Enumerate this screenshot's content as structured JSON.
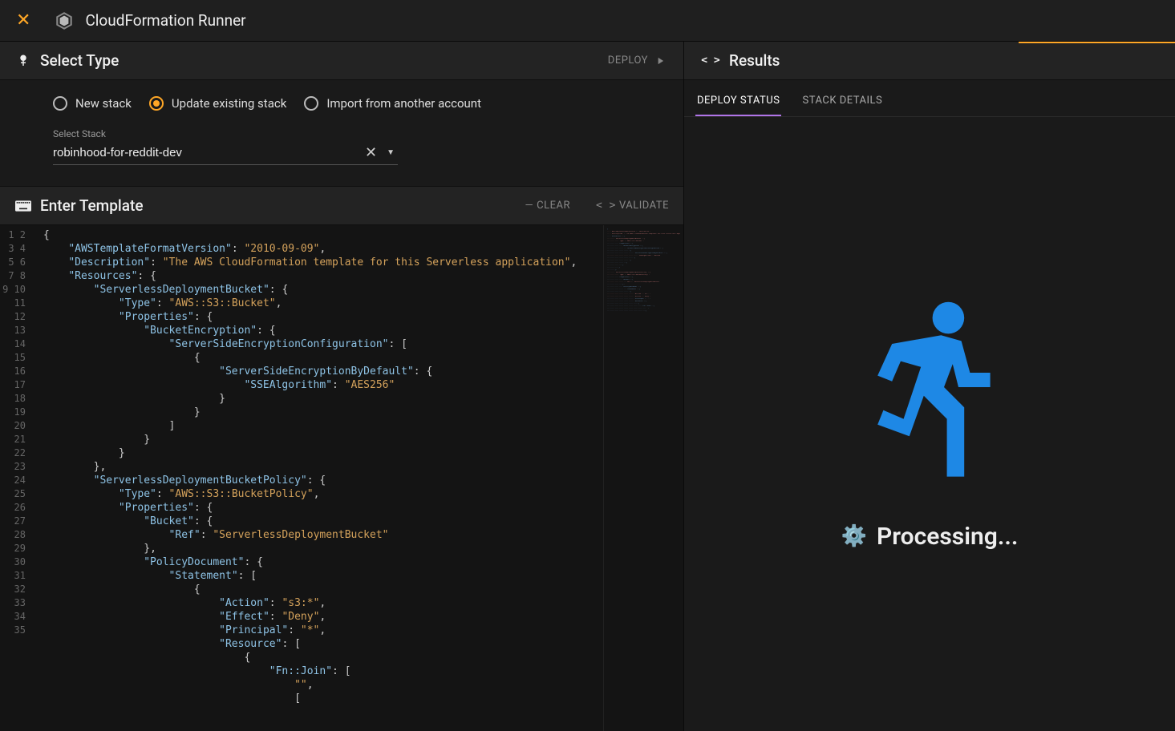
{
  "titlebar": {
    "app_name": "CloudFormation Runner"
  },
  "select_type": {
    "header": "Select Type",
    "deploy_label": "DEPLOY",
    "radios": {
      "new_stack": "New stack",
      "update_existing": "Update existing stack",
      "import": "Import from another account",
      "selected": "update_existing"
    },
    "stack_label": "Select Stack",
    "stack_value": "robinhood-for-reddit-dev"
  },
  "enter_template": {
    "header": "Enter Template",
    "clear_label": "CLEAR",
    "validate_label": "VALIDATE"
  },
  "code_lines": [
    [
      [
        "brace",
        "{"
      ]
    ],
    [
      [
        "sp",
        "    "
      ],
      [
        "key",
        "\"AWSTemplateFormatVersion\""
      ],
      [
        "punc",
        ": "
      ],
      [
        "str",
        "\"2010-09-09\""
      ],
      [
        "punc",
        ","
      ]
    ],
    [
      [
        "sp",
        "    "
      ],
      [
        "key",
        "\"Description\""
      ],
      [
        "punc",
        ": "
      ],
      [
        "str",
        "\"The AWS CloudFormation template for this Serverless application\""
      ],
      [
        "punc",
        ","
      ]
    ],
    [
      [
        "sp",
        "    "
      ],
      [
        "key",
        "\"Resources\""
      ],
      [
        "punc",
        ": "
      ],
      [
        "brace",
        "{"
      ]
    ],
    [
      [
        "sp",
        "        "
      ],
      [
        "key",
        "\"ServerlessDeploymentBucket\""
      ],
      [
        "punc",
        ": "
      ],
      [
        "brace",
        "{"
      ]
    ],
    [
      [
        "sp",
        "            "
      ],
      [
        "key",
        "\"Type\""
      ],
      [
        "punc",
        ": "
      ],
      [
        "str",
        "\"AWS::S3::Bucket\""
      ],
      [
        "punc",
        ","
      ]
    ],
    [
      [
        "sp",
        "            "
      ],
      [
        "key",
        "\"Properties\""
      ],
      [
        "punc",
        ": "
      ],
      [
        "brace",
        "{"
      ]
    ],
    [
      [
        "sp",
        "                "
      ],
      [
        "key",
        "\"BucketEncryption\""
      ],
      [
        "punc",
        ": "
      ],
      [
        "brace",
        "{"
      ]
    ],
    [
      [
        "sp",
        "                    "
      ],
      [
        "key",
        "\"ServerSideEncryptionConfiguration\""
      ],
      [
        "punc",
        ": "
      ],
      [
        "brace",
        "["
      ]
    ],
    [
      [
        "sp",
        "                        "
      ],
      [
        "brace",
        "{"
      ]
    ],
    [
      [
        "sp",
        "                            "
      ],
      [
        "key",
        "\"ServerSideEncryptionByDefault\""
      ],
      [
        "punc",
        ": "
      ],
      [
        "brace",
        "{"
      ]
    ],
    [
      [
        "sp",
        "                                "
      ],
      [
        "key",
        "\"SSEAlgorithm\""
      ],
      [
        "punc",
        ": "
      ],
      [
        "str",
        "\"AES256\""
      ]
    ],
    [
      [
        "sp",
        "                            "
      ],
      [
        "brace",
        "}"
      ]
    ],
    [
      [
        "sp",
        "                        "
      ],
      [
        "brace",
        "}"
      ]
    ],
    [
      [
        "sp",
        "                    "
      ],
      [
        "brace",
        "]"
      ]
    ],
    [
      [
        "sp",
        "                "
      ],
      [
        "brace",
        "}"
      ]
    ],
    [
      [
        "sp",
        "            "
      ],
      [
        "brace",
        "}"
      ]
    ],
    [
      [
        "sp",
        "        "
      ],
      [
        "brace",
        "}"
      ],
      [
        "punc",
        ","
      ]
    ],
    [
      [
        "sp",
        "        "
      ],
      [
        "key",
        "\"ServerlessDeploymentBucketPolicy\""
      ],
      [
        "punc",
        ": "
      ],
      [
        "brace",
        "{"
      ]
    ],
    [
      [
        "sp",
        "            "
      ],
      [
        "key",
        "\"Type\""
      ],
      [
        "punc",
        ": "
      ],
      [
        "str",
        "\"AWS::S3::BucketPolicy\""
      ],
      [
        "punc",
        ","
      ]
    ],
    [
      [
        "sp",
        "            "
      ],
      [
        "key",
        "\"Properties\""
      ],
      [
        "punc",
        ": "
      ],
      [
        "brace",
        "{"
      ]
    ],
    [
      [
        "sp",
        "                "
      ],
      [
        "key",
        "\"Bucket\""
      ],
      [
        "punc",
        ": "
      ],
      [
        "brace",
        "{"
      ]
    ],
    [
      [
        "sp",
        "                    "
      ],
      [
        "key",
        "\"Ref\""
      ],
      [
        "punc",
        ": "
      ],
      [
        "str",
        "\"ServerlessDeploymentBucket\""
      ]
    ],
    [
      [
        "sp",
        "                "
      ],
      [
        "brace",
        "}"
      ],
      [
        "punc",
        ","
      ]
    ],
    [
      [
        "sp",
        "                "
      ],
      [
        "key",
        "\"PolicyDocument\""
      ],
      [
        "punc",
        ": "
      ],
      [
        "brace",
        "{"
      ]
    ],
    [
      [
        "sp",
        "                    "
      ],
      [
        "key",
        "\"Statement\""
      ],
      [
        "punc",
        ": "
      ],
      [
        "brace",
        "["
      ]
    ],
    [
      [
        "sp",
        "                        "
      ],
      [
        "brace",
        "{"
      ]
    ],
    [
      [
        "sp",
        "                            "
      ],
      [
        "key",
        "\"Action\""
      ],
      [
        "punc",
        ": "
      ],
      [
        "str",
        "\"s3:*\""
      ],
      [
        "punc",
        ","
      ]
    ],
    [
      [
        "sp",
        "                            "
      ],
      [
        "key",
        "\"Effect\""
      ],
      [
        "punc",
        ": "
      ],
      [
        "str",
        "\"Deny\""
      ],
      [
        "punc",
        ","
      ]
    ],
    [
      [
        "sp",
        "                            "
      ],
      [
        "key",
        "\"Principal\""
      ],
      [
        "punc",
        ": "
      ],
      [
        "str",
        "\"*\""
      ],
      [
        "punc",
        ","
      ]
    ],
    [
      [
        "sp",
        "                            "
      ],
      [
        "key",
        "\"Resource\""
      ],
      [
        "punc",
        ": "
      ],
      [
        "brace",
        "["
      ]
    ],
    [
      [
        "sp",
        "                                "
      ],
      [
        "brace",
        "{"
      ]
    ],
    [
      [
        "sp",
        "                                    "
      ],
      [
        "key",
        "\"Fn::Join\""
      ],
      [
        "punc",
        ": "
      ],
      [
        "brace",
        "["
      ]
    ],
    [
      [
        "sp",
        "                                        "
      ],
      [
        "str",
        "\"\""
      ],
      [
        "punc",
        ","
      ]
    ],
    [
      [
        "sp",
        "                                        "
      ],
      [
        "brace",
        "["
      ]
    ]
  ],
  "results": {
    "header": "Results",
    "tabs": {
      "deploy_status": "DEPLOY STATUS",
      "stack_details": "STACK DETAILS"
    },
    "processing": "Processing..."
  }
}
